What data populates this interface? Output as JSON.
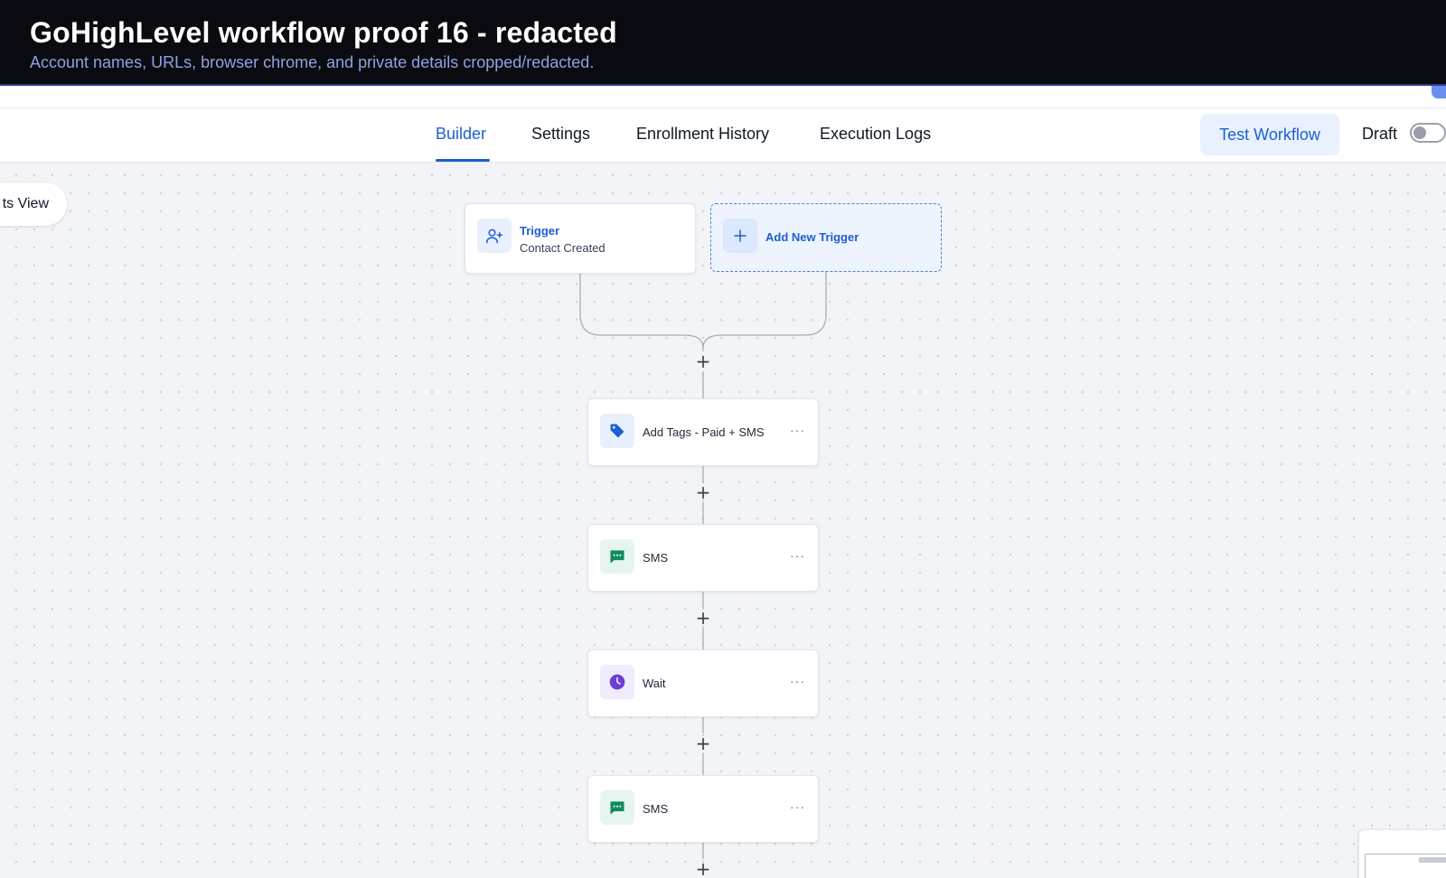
{
  "banner": {
    "title": "GoHighLevel workflow proof 16 - redacted",
    "subtitle": "Account names, URLs, browser chrome, and private details cropped/redacted."
  },
  "nav": {
    "tabs": [
      {
        "label": "Builder",
        "active": true
      },
      {
        "label": "Settings",
        "active": false
      },
      {
        "label": "Enrollment History",
        "active": false
      },
      {
        "label": "Execution Logs",
        "active": false
      }
    ],
    "test_button": "Test Workflow",
    "status_label": "Draft",
    "status_toggle_on": false
  },
  "canvas": {
    "view_toggle_label": "ts View",
    "trigger": {
      "title": "Trigger",
      "subtitle": "Contact Created",
      "icon": "user-plus-icon"
    },
    "add_trigger": {
      "label": "Add New Trigger",
      "icon": "plus-icon"
    },
    "add_step_symbol": "+",
    "more_symbol": "···",
    "actions": [
      {
        "label": "Add Tags - Paid + SMS",
        "icon": "tag-icon",
        "color": "#1d5fd1"
      },
      {
        "label": "SMS",
        "icon": "message-icon",
        "color": "#0f8a5f"
      },
      {
        "label": "Wait",
        "icon": "clock-icon",
        "color": "#6d3fd6"
      },
      {
        "label": "SMS",
        "icon": "message-icon",
        "color": "#0f8a5f"
      }
    ]
  },
  "colors": {
    "accent": "#1d5fd1",
    "banner_bg": "#0a0b10",
    "canvas_bg": "#f3f4f7"
  }
}
